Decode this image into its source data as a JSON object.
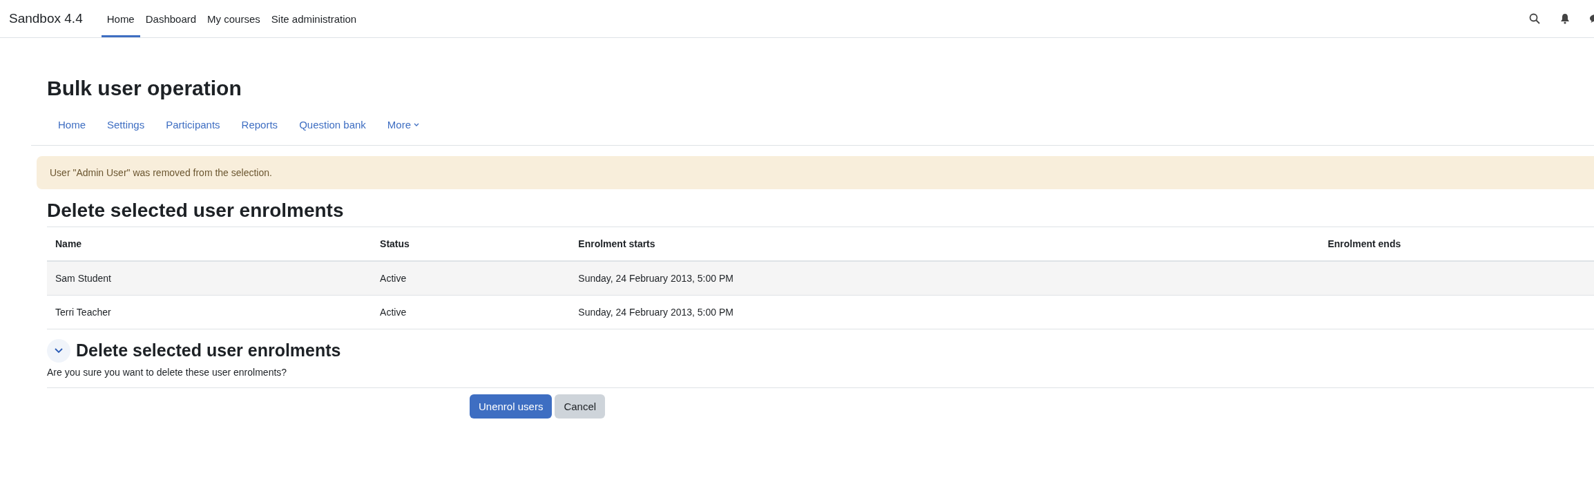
{
  "navbar": {
    "brand": "Sandbox 4.4",
    "items": [
      {
        "label": "Home",
        "selected": true
      },
      {
        "label": "Dashboard",
        "selected": false
      },
      {
        "label": "My courses",
        "selected": false
      },
      {
        "label": "Site administration",
        "selected": false
      }
    ]
  },
  "page_title": "Bulk user operation",
  "secondary_nav": [
    {
      "label": "Home"
    },
    {
      "label": "Settings"
    },
    {
      "label": "Participants"
    },
    {
      "label": "Reports"
    },
    {
      "label": "Question bank"
    },
    {
      "label": "More",
      "kind": "dropdown"
    }
  ],
  "alert": "User \"Admin User\" was removed from the selection.",
  "heading": "Delete selected user enrolments",
  "table": {
    "columns": [
      "Name",
      "Status",
      "Enrolment starts",
      "Enrolment ends"
    ],
    "rows": [
      [
        "Sam Student",
        "Active",
        "Sunday, 24 February 2013, 5:00 PM",
        ""
      ],
      [
        "Terri Teacher",
        "Active",
        "Sunday, 24 February 2013, 5:00 PM",
        ""
      ]
    ]
  },
  "section": {
    "title": "Delete selected user enrolments",
    "expanded": true,
    "question": "Are you sure you want to delete these user enrolments?"
  },
  "buttons": [
    {
      "label": "Unenrol users",
      "kind": "primary"
    },
    {
      "label": "Cancel",
      "kind": "secondary"
    }
  ]
}
